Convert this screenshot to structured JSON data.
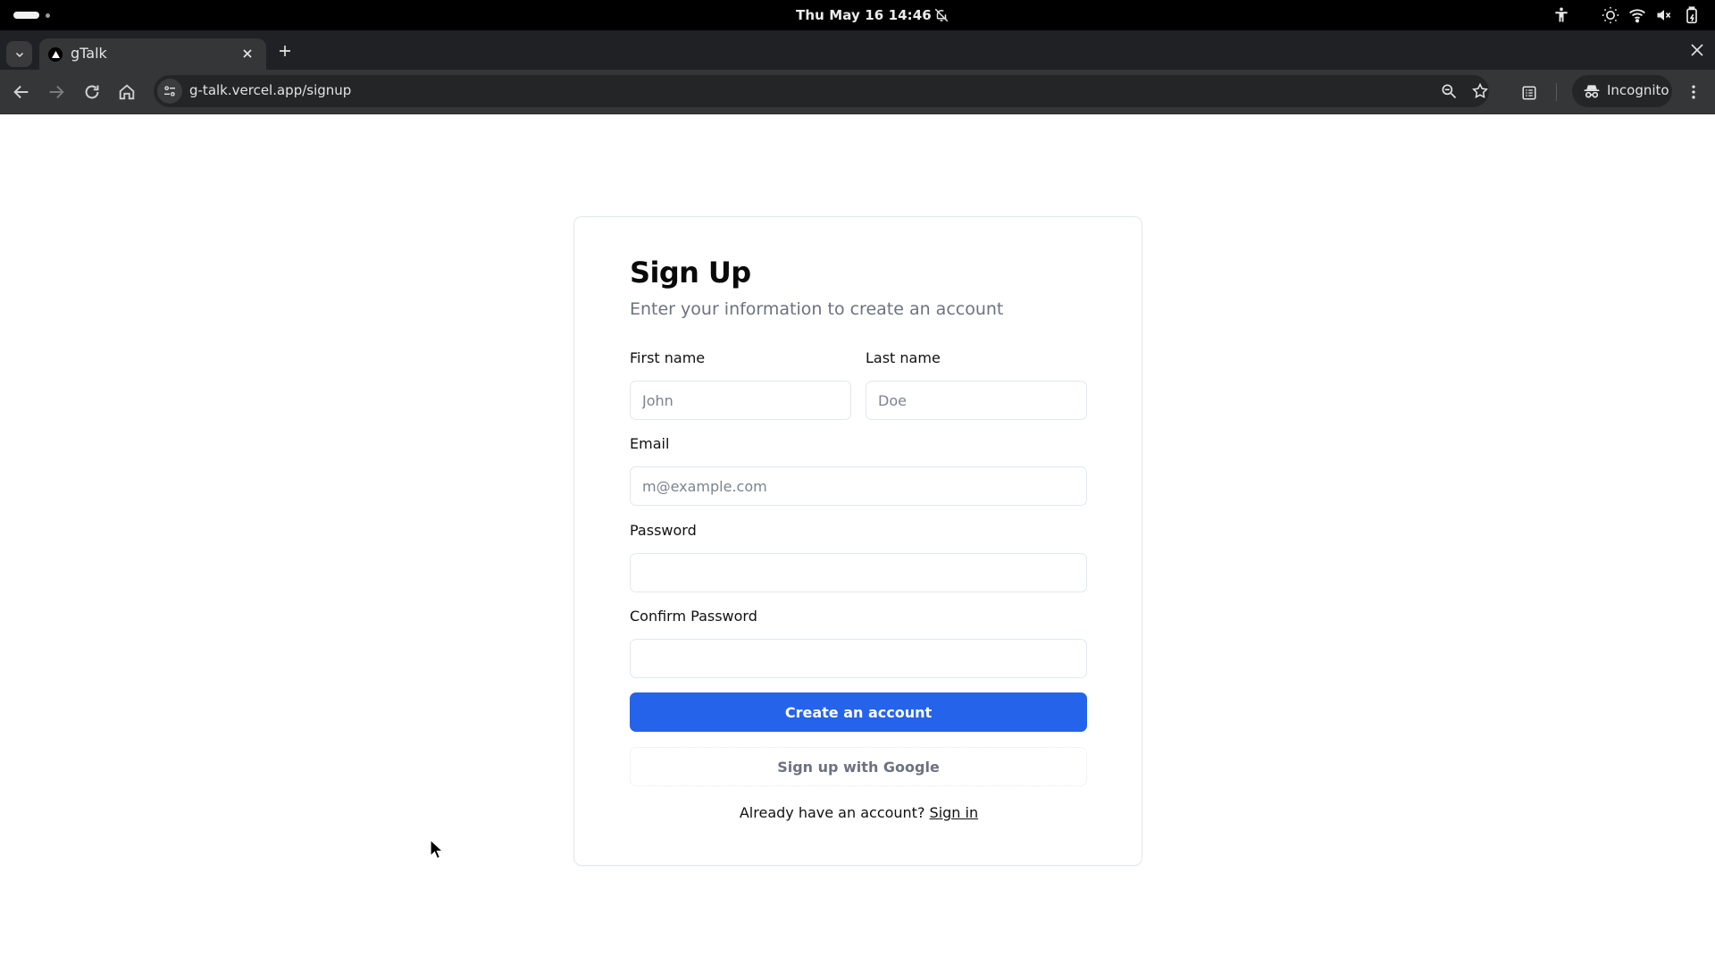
{
  "system": {
    "clock": "Thu May 16  14:46",
    "tray_icons": [
      "accessibility-icon",
      "night-light-icon",
      "wifi-icon",
      "volume-muted-icon",
      "battery-charging-icon"
    ]
  },
  "browser": {
    "tab": {
      "title": "gTalk",
      "favicon": "vercel-triangle-icon"
    },
    "url": "g-talk.vercel.app/signup",
    "profile_label": "Incognito"
  },
  "signup": {
    "title": "Sign Up",
    "subtitle": "Enter your information to create an account",
    "first_name": {
      "label": "First name",
      "placeholder": "John",
      "value": ""
    },
    "last_name": {
      "label": "Last name",
      "placeholder": "Doe",
      "value": ""
    },
    "email": {
      "label": "Email",
      "placeholder": "m@example.com",
      "value": ""
    },
    "password": {
      "label": "Password",
      "value": ""
    },
    "confirm_password": {
      "label": "Confirm Password",
      "value": ""
    },
    "create_button": "Create an account",
    "google_button": "Sign up with Google",
    "footer_prompt": "Already have an account?",
    "sign_in_link": "Sign in",
    "primary_color": "#2563eb"
  }
}
